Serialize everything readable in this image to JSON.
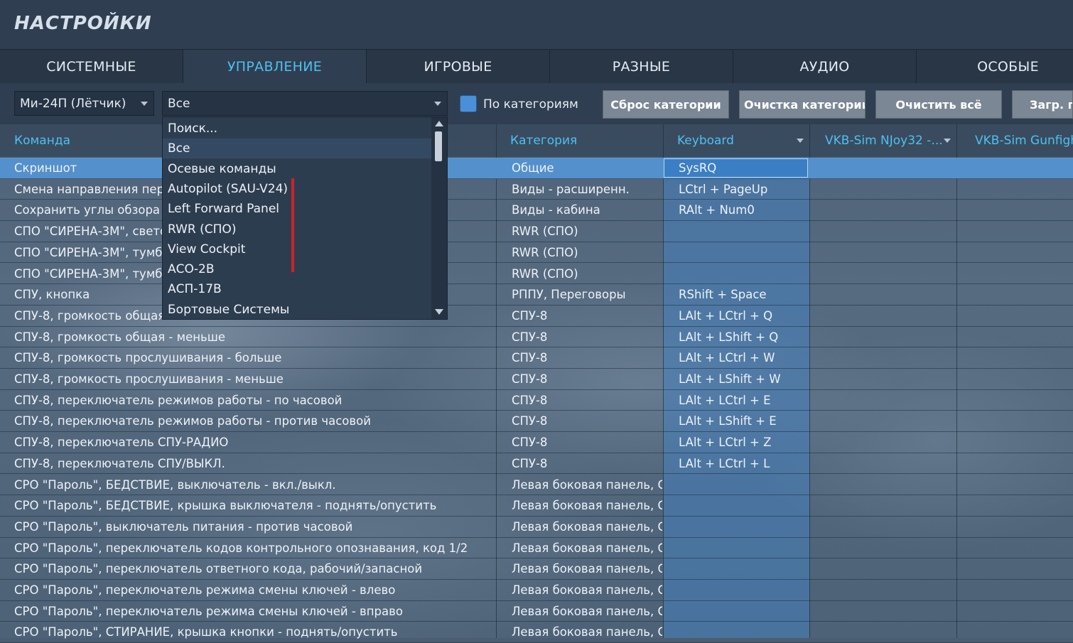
{
  "title": "НАСТРОЙКИ",
  "tabs": [
    {
      "label": "СИСТЕМНЫЕ",
      "active": false
    },
    {
      "label": "УПРАВЛЕНИЕ",
      "active": true
    },
    {
      "label": "ИГРОВЫЕ",
      "active": false
    },
    {
      "label": "РАЗНЫЕ",
      "active": false
    },
    {
      "label": "АУДИО",
      "active": false
    },
    {
      "label": "ОСОБЫЕ",
      "active": false
    }
  ],
  "toolbar": {
    "aircraft_select": "Ми-24П (Лётчик)",
    "category_select": "Все",
    "by_category_label": "По категориям",
    "by_category_checked": true,
    "buttons": [
      "Сброс категории",
      "Очистка категории",
      "Очистить всё",
      "Загр. п"
    ]
  },
  "columns": {
    "command": "Команда",
    "category": "Категория",
    "keyboard": "Keyboard",
    "device1": "VKB-Sim NJoy32 -...",
    "device2": "VKB-Sim Gunfigh"
  },
  "rows": [
    {
      "command": "Скриншот",
      "category": "Общие",
      "key": "SysRQ",
      "selected": true
    },
    {
      "command": "Смена направления пере",
      "category": "Виды - расширенн.",
      "key": "LCtrl + PageUp"
    },
    {
      "command": "Сохранить углы обзора",
      "category": "Виды - кабина",
      "key": "RAlt + Num0"
    },
    {
      "command": "СПО \"СИРЕНА-3М\", свето",
      "category": "RWR (СПО)",
      "key": ""
    },
    {
      "command": "СПО \"СИРЕНА-3М\", тумбл",
      "category": "RWR (СПО)",
      "key": ""
    },
    {
      "command": "СПО \"СИРЕНА-3М\", тумбл",
      "category": "RWR (СПО)",
      "key": ""
    },
    {
      "command": "СПУ, кнопка",
      "category": "РППУ, Переговоры",
      "key": "RShift + Space"
    },
    {
      "command": "СПУ-8, громкость общая - больше",
      "category": "СПУ-8",
      "key": "LAlt + LCtrl + Q"
    },
    {
      "command": "СПУ-8, громкость общая - меньше",
      "category": "СПУ-8",
      "key": "LAlt + LShift + Q"
    },
    {
      "command": "СПУ-8, громкость прослушивания - больше",
      "category": "СПУ-8",
      "key": "LAlt + LCtrl + W"
    },
    {
      "command": "СПУ-8, громкость прослушивания - меньше",
      "category": "СПУ-8",
      "key": "LAlt + LShift + W"
    },
    {
      "command": "СПУ-8, переключатель режимов работы - по часовой",
      "category": "СПУ-8",
      "key": "LAlt + LCtrl + E"
    },
    {
      "command": "СПУ-8, переключатель режимов работы - против часовой",
      "category": "СПУ-8",
      "key": "LAlt + LShift + E"
    },
    {
      "command": "СПУ-8, переключатель СПУ-РАДИО",
      "category": "СПУ-8",
      "key": "LAlt + LCtrl + Z"
    },
    {
      "command": "СПУ-8, переключатель СПУ/ВЫКЛ.",
      "category": "СПУ-8",
      "key": "LAlt + LCtrl + L"
    },
    {
      "command": "СРО \"Пароль\", БЕДСТВИЕ, выключатель - вкл./выкл.",
      "category": "Левая боковая панель, С",
      "key": ""
    },
    {
      "command": "СРО \"Пароль\", БЕДСТВИЕ, крышка выключателя - поднять/опустить",
      "category": "Левая боковая панель, С",
      "key": ""
    },
    {
      "command": "СРО \"Пароль\", выключатель питания - против часовой",
      "category": "Левая боковая панель, С",
      "key": ""
    },
    {
      "command": "СРО \"Пароль\", переключатель кодов контрольного опознавания, код 1/2",
      "category": "Левая боковая панель, С",
      "key": ""
    },
    {
      "command": "СРО \"Пароль\", переключатель ответного кода, рабочий/запасной",
      "category": "Левая боковая панель, С",
      "key": ""
    },
    {
      "command": "СРО \"Пароль\", переключатель режима смены ключей - влево",
      "category": "Левая боковая панель, С",
      "key": ""
    },
    {
      "command": "СРО \"Пароль\", переключатель режима смены ключей - вправо",
      "category": "Левая боковая панель, С",
      "key": ""
    },
    {
      "command": "СРО \"Пароль\", СТИРАНИЕ, крышка кнопки - поднять/опустить",
      "category": "Левая боковая панель, С",
      "key": ""
    }
  ],
  "dropdown": {
    "items": [
      "Поиск...",
      "Все",
      "Осевые команды",
      "Autopilot (SAU-V24)",
      "Left Forward Panel",
      "RWR (СПО)",
      "View Cockpit",
      "АСО-2В",
      "АСП-17В",
      "Бортовые Системы"
    ],
    "active_index": 1
  }
}
